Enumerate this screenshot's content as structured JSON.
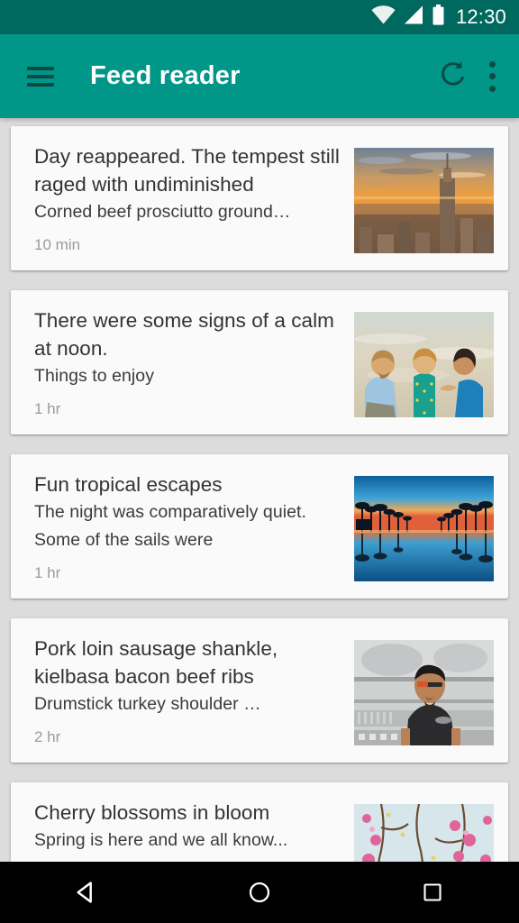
{
  "status_bar": {
    "clock": "12:30",
    "icons": [
      "wifi-icon",
      "cellular-signal-icon",
      "battery-icon"
    ],
    "background_color": "#00695f"
  },
  "app_bar": {
    "title": "Feed reader",
    "nav_icon": "hamburger-menu-icon",
    "refresh_label": "refresh-icon",
    "overflow_label": "more-options-icon",
    "background_color": "#009688",
    "title_color": "#ffffff",
    "icon_color": "#0d4a44"
  },
  "feed": {
    "background_color": "#dcdcdc",
    "card_color": "#fafafa",
    "items": [
      {
        "title": "Day reappeared. The tempest still raged with undiminished",
        "description": "Corned beef prosciutto ground…",
        "time": "10 min",
        "thumb": "city-skyline-sunset-thumbnail"
      },
      {
        "title": "There were some signs of a calm at noon.",
        "description": "Things to enjoy",
        "time": "1 hr",
        "thumb": "family-on-beach-thumbnail"
      },
      {
        "title": "Fun tropical escapes",
        "description": "The night was comparatively quiet. Some of the sails were",
        "time": "1 hr",
        "thumb": "tropical-palm-lagoon-thumbnail"
      },
      {
        "title": "Pork loin sausage shankle, kielbasa bacon beef ribs",
        "description": "Drumstick turkey shoulder …",
        "time": "2 hr",
        "thumb": "man-in-kitchen-thumbnail"
      },
      {
        "title": "Cherry blossoms in bloom",
        "description": "Spring is here and we all know...",
        "time": "",
        "thumb": "cherry-blossom-thumbnail"
      }
    ]
  },
  "nav_bar": {
    "background_color": "#000000",
    "buttons": [
      "back-button",
      "home-button",
      "recents-button"
    ]
  }
}
